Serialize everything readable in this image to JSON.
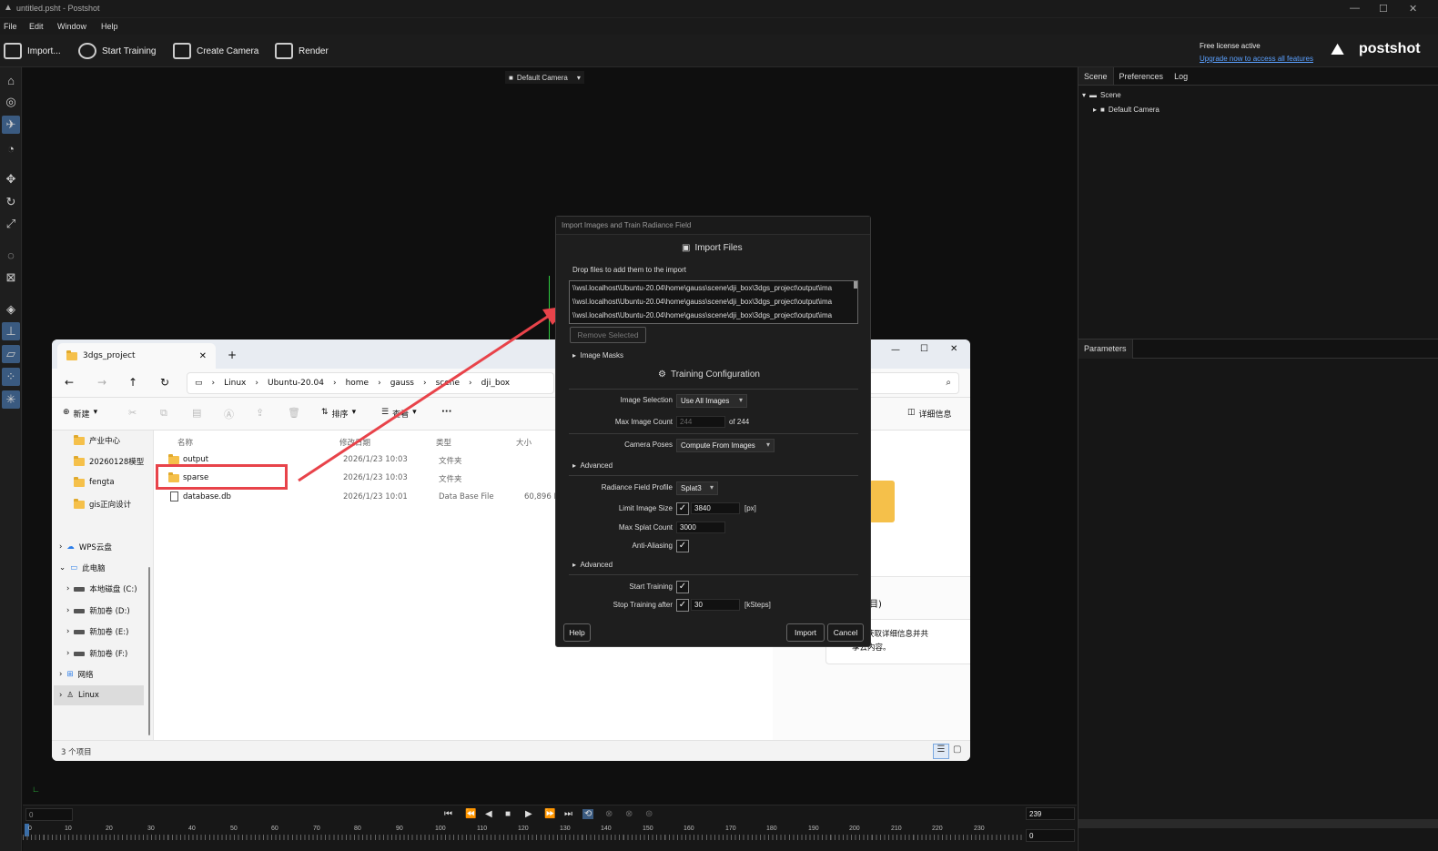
{
  "window": {
    "title": "untitled.psht - Postshot"
  },
  "menu": [
    "File",
    "Edit",
    "Window",
    "Help"
  ],
  "toolbar": {
    "import": "Import...",
    "start_training": "Start Training",
    "create_camera": "Create Camera",
    "render": "Render"
  },
  "license": {
    "status": "Free license active",
    "link": "Upgrade now to access all features",
    "brand": "postshot"
  },
  "viewport": {
    "camera_select": "Default Camera"
  },
  "right_panel": {
    "tabs": [
      "Scene",
      "Preferences",
      "Log"
    ],
    "tree_root": "Scene",
    "tree_child": "Default Camera",
    "parameters_tab": "Parameters"
  },
  "explorer": {
    "tab_title": "3dgs_project",
    "breadcrumb": [
      "Linux",
      "Ubuntu-20.04",
      "home",
      "gauss",
      "scene",
      "dji_box"
    ],
    "cmd": {
      "new": "新建",
      "sort": "排序",
      "view": "查看",
      "more": "···",
      "details": "详细信息"
    },
    "nav": [
      {
        "label": "产业中心",
        "type": "folder"
      },
      {
        "label": "20260128模型",
        "type": "folder"
      },
      {
        "label": "fengta",
        "type": "folder"
      },
      {
        "label": "gis正向设计",
        "type": "folder"
      },
      {
        "label": "WPS云盘",
        "type": "cloud"
      },
      {
        "label": "此电脑",
        "type": "pc"
      },
      {
        "label": "本地磁盘 (C:)",
        "type": "drive"
      },
      {
        "label": "新加卷 (D:)",
        "type": "drive"
      },
      {
        "label": "新加卷 (E:)",
        "type": "drive"
      },
      {
        "label": "新加卷 (F:)",
        "type": "drive"
      },
      {
        "label": "网络",
        "type": "net"
      },
      {
        "label": "Linux",
        "type": "linux"
      }
    ],
    "columns": {
      "name": "名称",
      "modified": "修改日期",
      "type": "类型",
      "size": "大小"
    },
    "files": [
      {
        "name": "output",
        "modified": "2026/1/23 10:03",
        "type": "文件夹",
        "size": ""
      },
      {
        "name": "sparse",
        "modified": "2026/1/23 10:03",
        "type": "文件夹",
        "size": ""
      },
      {
        "name": "database.db",
        "modified": "2026/1/23 10:01",
        "type": "Data Base File",
        "size": "60,896 K"
      }
    ],
    "status": "3 个项目",
    "preview_text1": "目)",
    "preview_text2": "获取详细信息并共",
    "preview_text3": "享云内容。"
  },
  "dialog": {
    "title": "Import Images and Train Radiance Field",
    "import_files_header": "Import Files",
    "drop_hint": "Drop files to add them to the import",
    "files": [
      "\\\\wsl.localhost\\Ubuntu-20.04\\home\\gauss\\scene\\dji_box\\3dgs_project\\output\\ima",
      "\\\\wsl.localhost\\Ubuntu-20.04\\home\\gauss\\scene\\dji_box\\3dgs_project\\output\\ima",
      "\\\\wsl.localhost\\Ubuntu-20.04\\home\\gauss\\scene\\dji_box\\3dgs_project\\output\\ima"
    ],
    "remove_selected": "Remove Selected",
    "image_masks": "Image Masks",
    "training_header": "Training Configuration",
    "image_selection_label": "Image Selection",
    "image_selection_value": "Use All Images",
    "max_image_count_label": "Max Image Count",
    "max_image_count_value": "244",
    "max_image_count_of": "of 244",
    "camera_poses_label": "Camera Poses",
    "camera_poses_value": "Compute From Images",
    "advanced1": "Advanced",
    "profile_label": "Radiance Field Profile",
    "profile_value": "Splat3",
    "limit_size_label": "Limit Image Size",
    "limit_size_value": "3840",
    "limit_size_unit": "[px]",
    "max_splat_label": "Max Splat Count",
    "max_splat_value": "3000",
    "anti_alias_label": "Anti-Aliasing",
    "advanced2": "Advanced",
    "start_training_label": "Start Training",
    "stop_after_label": "Stop Training after",
    "stop_after_value": "30",
    "stop_after_unit": "[kSteps]",
    "help": "Help",
    "import": "Import",
    "cancel": "Cancel"
  },
  "timeline": {
    "start": "0",
    "end": "239",
    "current": "0",
    "ticks": [
      "0",
      "10",
      "20",
      "30",
      "40",
      "50",
      "60",
      "70",
      "80",
      "90",
      "100",
      "110",
      "120",
      "130",
      "140",
      "150",
      "160",
      "170",
      "180",
      "190",
      "200",
      "210",
      "220",
      "230"
    ]
  },
  "colors": {
    "accent": "#3a5a80",
    "highlight_box": "#e8434a",
    "arrow": "#e8434a"
  }
}
